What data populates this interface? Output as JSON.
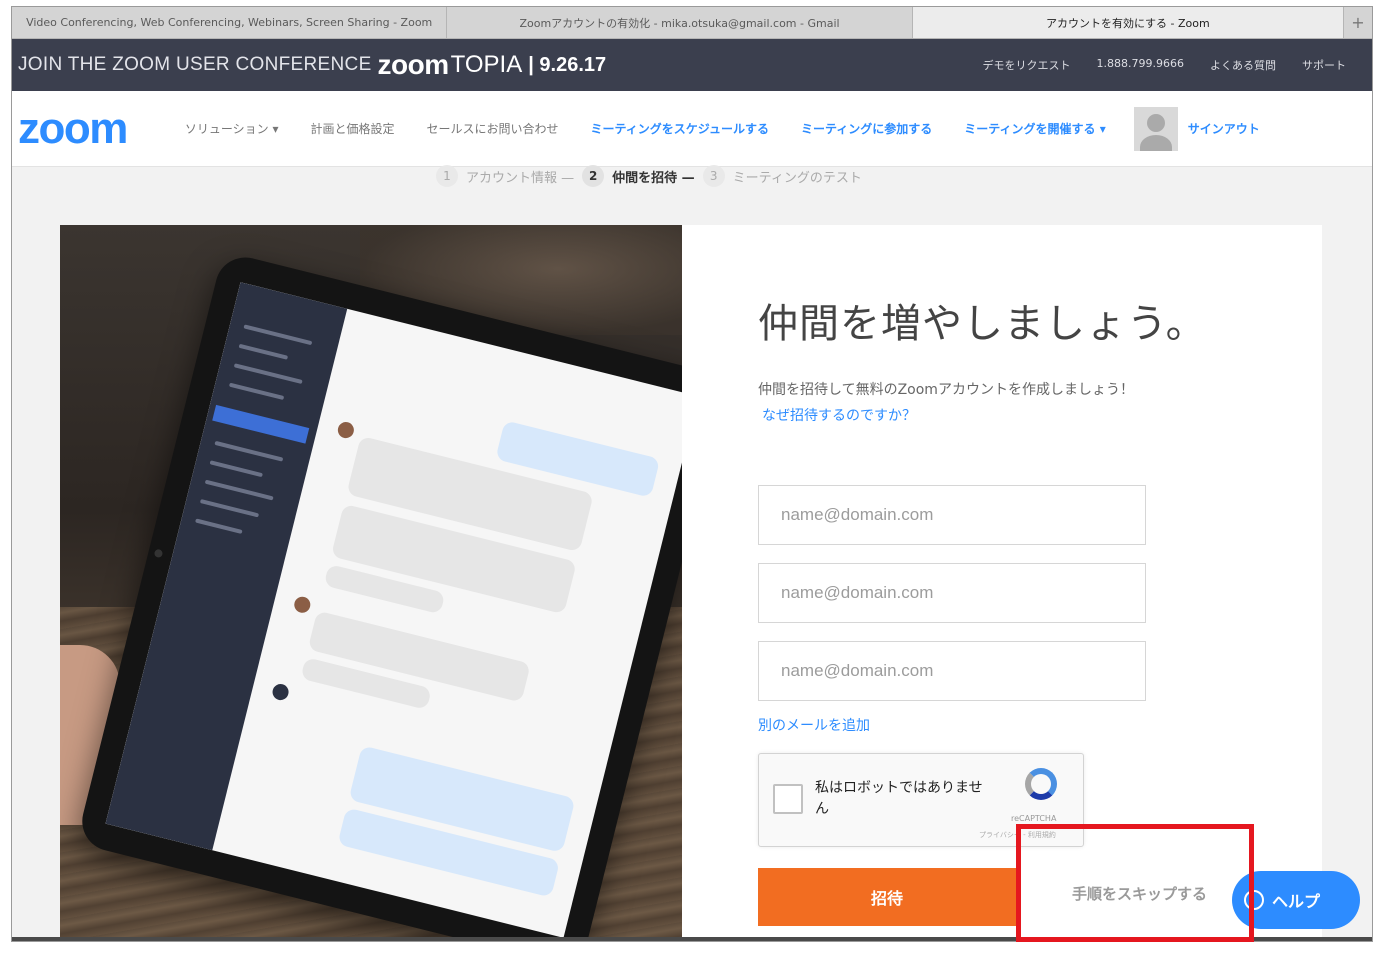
{
  "browser": {
    "tabs": [
      "Video Conferencing, Web Conferencing, Webinars, Screen Sharing - Zoom",
      "Zoomアカウントの有効化 - mika.otsuka@gmail.com - Gmail",
      "アカウントを有効にする - Zoom"
    ],
    "new_tab": "+"
  },
  "promo": {
    "text": "JOIN THE ZOOM USER CONFERENCE",
    "brand": "zoom",
    "brand_suffix": "TOPIA",
    "date": "| 9.26.17",
    "links": [
      "デモをリクエスト",
      "1.888.799.9666",
      "よくある質問",
      "サポート"
    ]
  },
  "nav": {
    "logo": "zoom",
    "items": [
      "ソリューション ▾",
      "計画と価格設定",
      "セールスにお問い合わせ"
    ],
    "blue_items": [
      "ミーティングをスケジュールする",
      "ミーティングに参加する",
      "ミーティングを開催する ▾"
    ],
    "signout": "サインアウト"
  },
  "stepper": {
    "steps": [
      {
        "num": "1",
        "label": "アカウント情報 —"
      },
      {
        "num": "2",
        "label": "仲間を招待 —"
      },
      {
        "num": "3",
        "label": "ミーティングのテスト"
      }
    ],
    "active": "2"
  },
  "form": {
    "heading": "仲間を増やしましょう。",
    "description": "仲間を招待して無料のZoomアカウントを作成しましょう！",
    "why_link": "なぜ招待するのですか？",
    "email_placeholder": "name@domain.com",
    "add_email": "別のメールを追加",
    "captcha_label": "私はロボットではありません",
    "captcha_brand": "reCAPTCHA",
    "captcha_privacy": "プライバシー - 利用規約",
    "invite_button": "招待",
    "skip_link": "手順をスキップする",
    "help_button": "ヘルプ"
  },
  "colors": {
    "accent": "#2d8cff",
    "invite": "#f26d21",
    "highlight": "#e5171f",
    "promo_bg": "#3b3f4e"
  }
}
